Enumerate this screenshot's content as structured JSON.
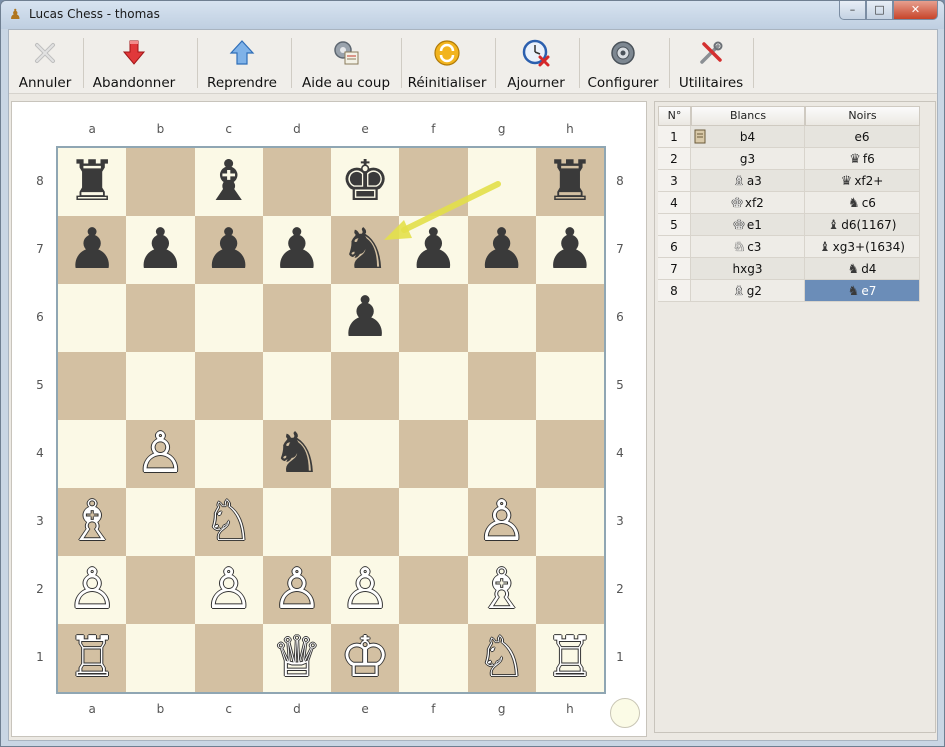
{
  "window": {
    "title": "Lucas Chess - thomas",
    "controls": {
      "minimize": "–",
      "maximize": "□",
      "close": "✕"
    }
  },
  "toolbar": {
    "items": [
      {
        "label": "Annuler",
        "icon": "cancel-x-icon"
      },
      {
        "label": "Abandonner",
        "icon": "red-down-arrow-icon"
      },
      {
        "label": "Reprendre",
        "icon": "blue-up-arrow-icon"
      },
      {
        "label": "Aide au coup",
        "icon": "gear-help-icon"
      },
      {
        "label": "Réinitialiser",
        "icon": "reset-circle-icon"
      },
      {
        "label": "Ajourner",
        "icon": "clock-icon"
      },
      {
        "label": "Configurer",
        "icon": "configure-gear-icon"
      },
      {
        "label": "Utilitaires",
        "icon": "tools-icon"
      }
    ]
  },
  "board": {
    "files": [
      "a",
      "b",
      "c",
      "d",
      "e",
      "f",
      "g",
      "h"
    ],
    "ranks": [
      "8",
      "7",
      "6",
      "5",
      "4",
      "3",
      "2",
      "1"
    ],
    "pieces": [
      {
        "square": "a8",
        "glyph": "♜",
        "color": "b"
      },
      {
        "square": "c8",
        "glyph": "♝",
        "color": "b"
      },
      {
        "square": "e8",
        "glyph": "♚",
        "color": "b"
      },
      {
        "square": "h8",
        "glyph": "♜",
        "color": "b"
      },
      {
        "square": "a7",
        "glyph": "♟",
        "color": "b"
      },
      {
        "square": "b7",
        "glyph": "♟",
        "color": "b"
      },
      {
        "square": "c7",
        "glyph": "♟",
        "color": "b"
      },
      {
        "square": "d7",
        "glyph": "♟",
        "color": "b"
      },
      {
        "square": "e7",
        "glyph": "♞",
        "color": "b"
      },
      {
        "square": "f7",
        "glyph": "♟",
        "color": "b"
      },
      {
        "square": "g7",
        "glyph": "♟",
        "color": "b"
      },
      {
        "square": "h7",
        "glyph": "♟",
        "color": "b"
      },
      {
        "square": "e6",
        "glyph": "♟",
        "color": "b"
      },
      {
        "square": "b4",
        "glyph": "♙",
        "color": "w"
      },
      {
        "square": "d4",
        "glyph": "♞",
        "color": "b"
      },
      {
        "square": "a3",
        "glyph": "♗",
        "color": "w"
      },
      {
        "square": "c3",
        "glyph": "♘",
        "color": "w"
      },
      {
        "square": "g3",
        "glyph": "♙",
        "color": "w"
      },
      {
        "square": "a2",
        "glyph": "♙",
        "color": "w"
      },
      {
        "square": "c2",
        "glyph": "♙",
        "color": "w"
      },
      {
        "square": "d2",
        "glyph": "♙",
        "color": "w"
      },
      {
        "square": "e2",
        "glyph": "♙",
        "color": "w"
      },
      {
        "square": "g2",
        "glyph": "♗",
        "color": "w"
      },
      {
        "square": "a1",
        "glyph": "♖",
        "color": "w"
      },
      {
        "square": "d1",
        "glyph": "♕",
        "color": "w"
      },
      {
        "square": "e1",
        "glyph": "♔",
        "color": "w"
      },
      {
        "square": "g1",
        "glyph": "♘",
        "color": "w"
      },
      {
        "square": "h1",
        "glyph": "♖",
        "color": "w"
      }
    ],
    "last_move_arrow": {
      "from": "g8",
      "to": "e7",
      "color": "#e3e04a"
    },
    "colors": {
      "light": "#fbf9e6",
      "dark": "#d3c0a2",
      "border": "#8fa6b3"
    }
  },
  "moves": {
    "headers": {
      "num": "N°",
      "white": "Blancs",
      "black": "Noirs"
    },
    "rows": [
      {
        "num": "1",
        "white": "b4",
        "white_piece": "",
        "black": "e6",
        "black_piece": "",
        "book": true
      },
      {
        "num": "2",
        "white": "g3",
        "white_piece": "",
        "black": "f6",
        "black_piece": "♛"
      },
      {
        "num": "3",
        "white": "a3",
        "white_piece": "♗",
        "black": "xf2+",
        "black_piece": "♛"
      },
      {
        "num": "4",
        "white": "xf2",
        "white_piece": "♔",
        "black": "c6",
        "black_piece": "♞"
      },
      {
        "num": "5",
        "white": "e1",
        "white_piece": "♔",
        "black": "d6(1167)",
        "black_piece": "♝"
      },
      {
        "num": "6",
        "white": "c3",
        "white_piece": "♘",
        "black": "xg3+(1634)",
        "black_piece": "♝"
      },
      {
        "num": "7",
        "white": "hxg3",
        "white_piece": "",
        "black": "d4",
        "black_piece": "♞"
      },
      {
        "num": "8",
        "white": "g2",
        "white_piece": "♗",
        "black": "e7",
        "black_piece": "♞",
        "selected": "black"
      }
    ]
  }
}
